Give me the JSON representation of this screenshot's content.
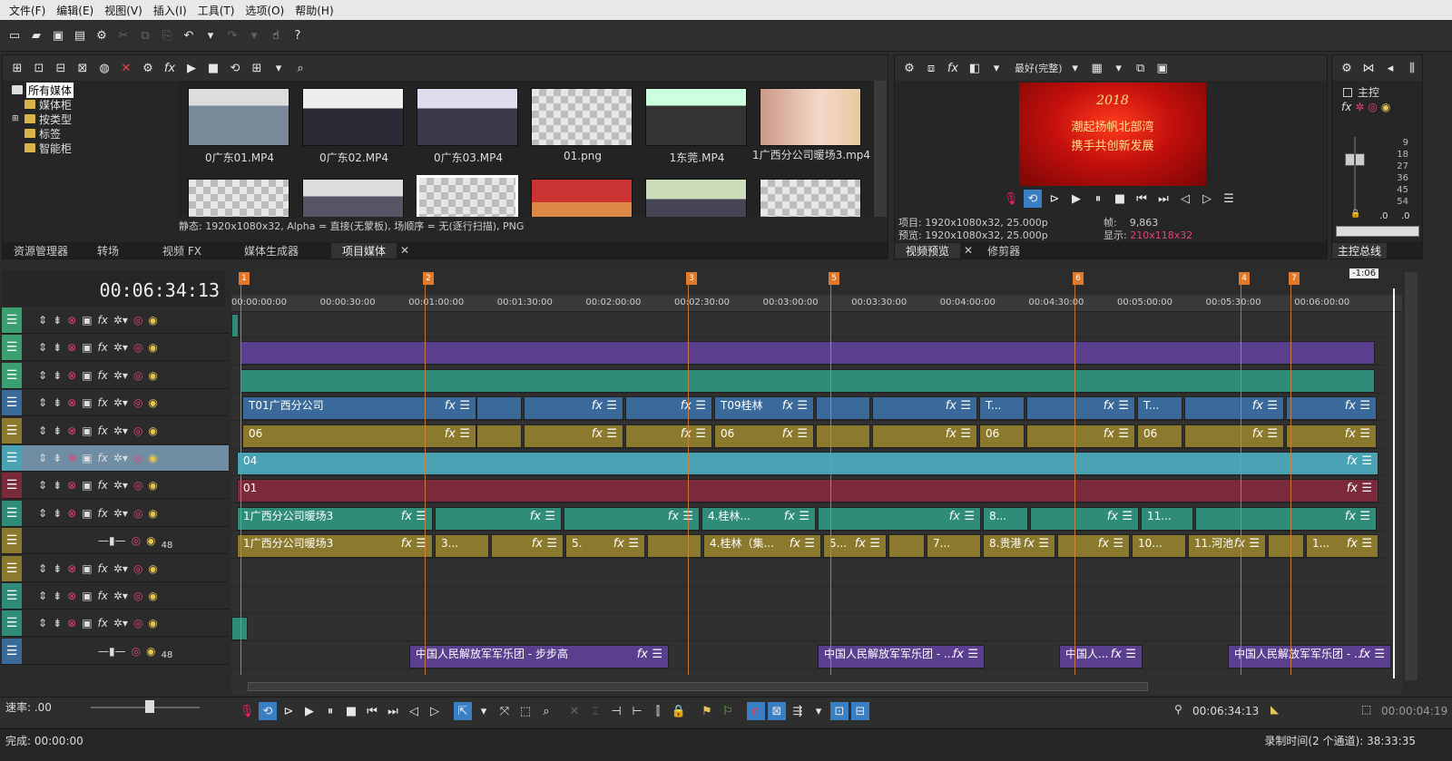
{
  "menu": [
    "文件(F)",
    "编辑(E)",
    "视图(V)",
    "插入(I)",
    "工具(T)",
    "选项(O)",
    "帮助(H)"
  ],
  "media": {
    "tree": [
      "所有媒体",
      "媒体柜",
      "按类型",
      "标签",
      "智能柜"
    ],
    "thumbs": [
      "0广东01.MP4",
      "0广东02.MP4",
      "0广东03.MP4",
      "01.png",
      "1东莞.MP4",
      "1广西分公司暖场3.mp4"
    ],
    "status": "静态: 1920x1080x32, Alpha = 直接(无蒙板), 场顺序 = 无(逐行扫描), PNG",
    "tabs": [
      "资源管理器",
      "转场",
      "视频 FX",
      "媒体生成器",
      "项目媒体"
    ]
  },
  "preview": {
    "quality": "最好(完整)",
    "slide_line1": "2018",
    "slide_line2": "潮起扬帆北部湾",
    "slide_line3": "携手共创新发展",
    "project": "项目: 1920x1080x32, 25.000p",
    "preview_info": "预览: 1920x1080x32, 25.000p",
    "frame_label": "帧:",
    "frame": "9,863",
    "display_label": "显示:",
    "display": "210x118x32",
    "tabs": [
      "视频预览",
      "修剪器"
    ]
  },
  "master": {
    "label": "主控",
    "scale": [
      "9",
      "18",
      "27",
      "36",
      "45",
      "54"
    ],
    "vals": [
      ".0",
      ".0"
    ],
    "tab": "主控总线"
  },
  "timeline": {
    "timecode": "00:06:34:13",
    "end_marker": "-1:06",
    "ruler": [
      "00:00:00:00",
      "00:00:30:00",
      "00:01:00:00",
      "00:01:30:00",
      "00:02:00:00",
      "00:02:30:00",
      "00:03:00:00",
      "00:03:30:00",
      "00:04:00:00",
      "00:04:30:00",
      "00:05:00:00",
      "00:05:30:00",
      "00:06:00:00"
    ],
    "markers": [
      "1",
      "2",
      "3",
      "5",
      "6",
      "4",
      "7"
    ],
    "clips": {
      "t4a": "T01广西分公司",
      "t4b": "T09桂林",
      "t4c": "T...",
      "t4d": "T...",
      "t5a": "06",
      "t5b": "06",
      "t5c": "06",
      "t5d": "06",
      "t6": "04",
      "t7": "01",
      "t8a": "1广西分公司暖场3",
      "t8b": "4.桂林...",
      "t8c": "8...",
      "t8d": "11...",
      "t9a": "1广西分公司暖场3",
      "t9b": "3...",
      "t9c": "5.",
      "t9d": "4.桂林（集...",
      "t9e": "5...",
      "t9f": "7...",
      "t9g": "8.贵港",
      "t9h": "10...",
      "t9i": "11.河池",
      "t9j": "1...",
      "a1": "中国人民解放军军乐团 - 步步高",
      "a2": "中国人民解放军军乐团 - ...",
      "a3": "中国人...",
      "a4": "中国人民解放军军乐团 - ..."
    },
    "vol_a": "48",
    "vol_b": "48"
  },
  "transport": {
    "rate": "速率: .00",
    "pos": "00:06:34:13",
    "dur": "00:00:04:19"
  },
  "status": {
    "done": "完成: 00:00:00",
    "record": "录制时间(2 个通道): 38:33:35"
  },
  "colors": {
    "purple": "#5a3f8f",
    "teal": "#2f8c79",
    "blue": "#3a6a9a",
    "olive": "#8b7a2e",
    "cyan": "#4aa3b4",
    "maroon": "#7a2a3a",
    "marker": "#e07a2a"
  }
}
